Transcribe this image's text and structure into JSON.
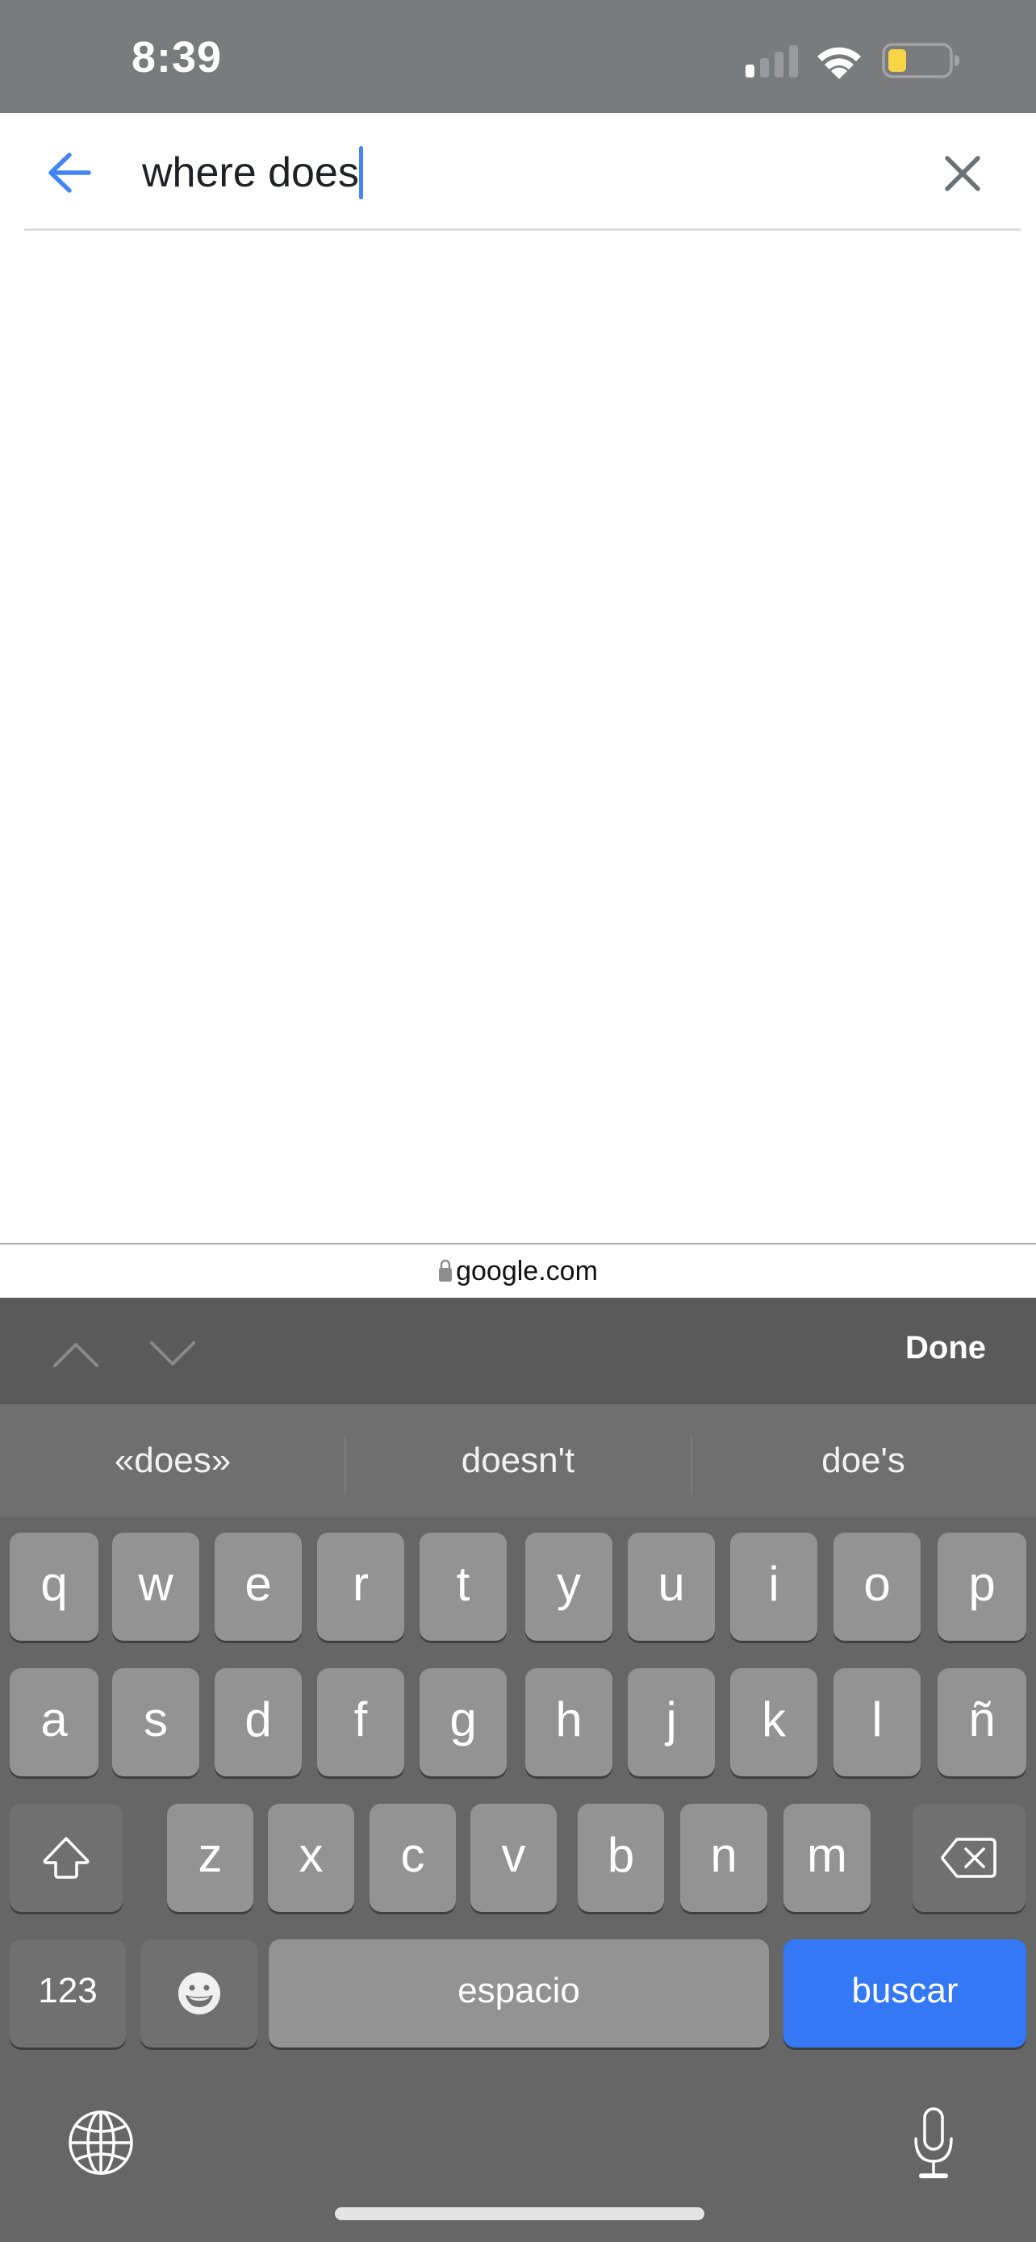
{
  "status_bar": {
    "time": "8:39",
    "signal_bars_active": 1,
    "signal_bars_total": 4,
    "wifi": "connected",
    "battery_level": 0.25,
    "battery_color": "#f7d547",
    "icons": [
      "cellular-signal-icon",
      "wifi-icon",
      "battery-icon"
    ]
  },
  "search": {
    "query": "where does",
    "back_icon": "arrow-left-icon",
    "clear_icon": "close-icon",
    "accent_color": "#4285f4"
  },
  "url_bar": {
    "domain": "google.com",
    "icon": "lock-icon"
  },
  "toolbar": {
    "prev_icon": "chevron-up-icon",
    "next_icon": "chevron-down-icon",
    "done_label": "Done"
  },
  "suggestions": [
    "«does»",
    "doesn't",
    "doe's"
  ],
  "keyboard": {
    "row1": [
      "q",
      "w",
      "e",
      "r",
      "t",
      "y",
      "u",
      "i",
      "o",
      "p"
    ],
    "row2": [
      "a",
      "s",
      "d",
      "f",
      "g",
      "h",
      "j",
      "k",
      "l",
      "ñ"
    ],
    "row3": [
      "z",
      "x",
      "c",
      "v",
      "b",
      "n",
      "m"
    ],
    "shift_icon": "shift-icon",
    "backspace_icon": "backspace-icon",
    "numbers_label": "123",
    "emoji_icon": "emoji-icon",
    "space_label": "espacio",
    "return_label": "buscar",
    "return_color": "#3478f6",
    "globe_icon": "globe-icon",
    "mic_icon": "microphone-icon"
  }
}
